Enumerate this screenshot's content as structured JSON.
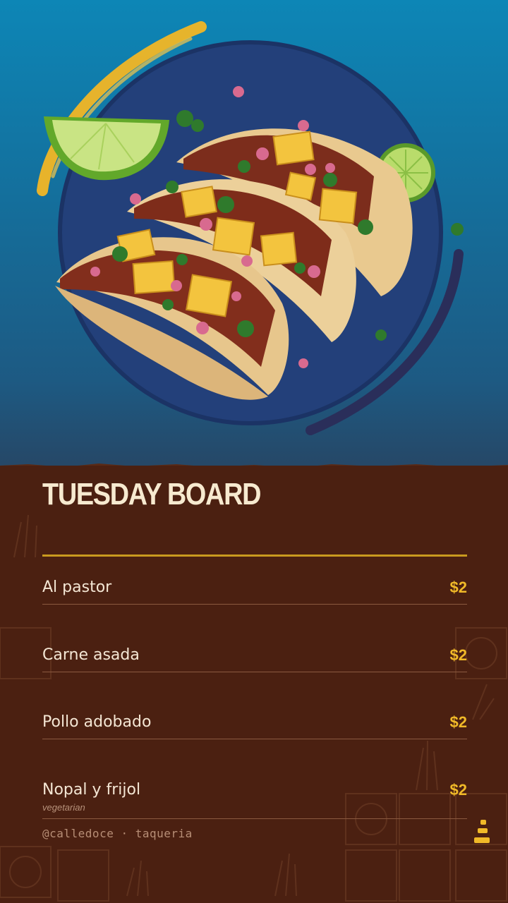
{
  "board": {
    "title": "TUESDAY BOARD"
  },
  "menu": {
    "items": [
      {
        "name": "Al pastor",
        "price": "$2",
        "note": ""
      },
      {
        "name": "Carne asada",
        "price": "$2",
        "note": ""
      },
      {
        "name": "Pollo adobado",
        "price": "$2",
        "note": ""
      },
      {
        "name": "Nopal y frijol",
        "price": "$2",
        "note": "vegetarian"
      }
    ]
  },
  "footer": {
    "handle": "@calledoce · taqueria",
    "logo_icon": "bars-logo-icon"
  },
  "colors": {
    "sky_top": "#0d86b6",
    "circle": "#23407a",
    "panel": "#4b2011",
    "title": "#f7ead0",
    "accent_gold": "#f0b928",
    "rule_gold": "#c99a1f",
    "divider": "#8b5a40",
    "muted_text": "#b78e76"
  }
}
